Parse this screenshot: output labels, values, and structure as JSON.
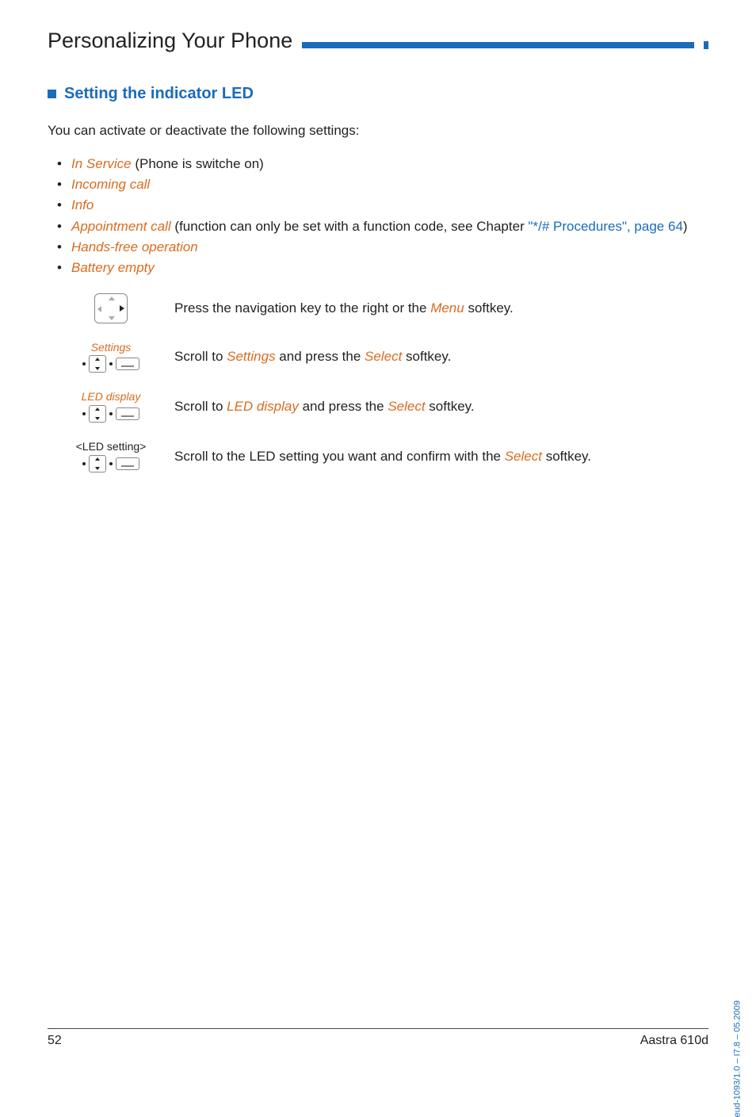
{
  "page": {
    "title": "Personalizing Your Phone",
    "number": "52",
    "product": "Aastra 610d",
    "side_id": "eud-1093/1.0 – I7.8 – 05.2009"
  },
  "section": {
    "heading": "Setting the indicator LED",
    "intro": "You can activate or deactivate the following settings:"
  },
  "bullets": {
    "b1": {
      "orange": "In Service",
      "rest": " (Phone is switche on)"
    },
    "b2": {
      "orange": "Incoming call"
    },
    "b3": {
      "orange": "Info"
    },
    "b4": {
      "orange": "Appointment call",
      "rest_before_link": " (function can only be set with a function code, see Chapter ",
      "link": "\"*/# Procedures\"",
      "comma": ", page ",
      "page_ref": "64",
      "close": ")"
    },
    "b5": {
      "orange": "Hands-free operation"
    },
    "b6": {
      "orange": "Battery empty"
    }
  },
  "steps": {
    "s1": {
      "text_before": "Press the navigation key to the right or the ",
      "menu": "Menu",
      "text_after": " softkey."
    },
    "s2": {
      "caption": "Settings",
      "t1": "Scroll to ",
      "o1": "Settings",
      "t2": " and press the ",
      "o2": "Select",
      "t3": "  softkey."
    },
    "s3": {
      "caption": "LED display",
      "t1": "Scroll to ",
      "o1": "LED display",
      "t2": " and press the ",
      "o2": "Select",
      "t3": " softkey."
    },
    "s4": {
      "caption": "<LED setting>",
      "t1": "Scroll to the LED setting you want and confirm with the ",
      "o1": "Select",
      "t2": " softkey."
    }
  }
}
